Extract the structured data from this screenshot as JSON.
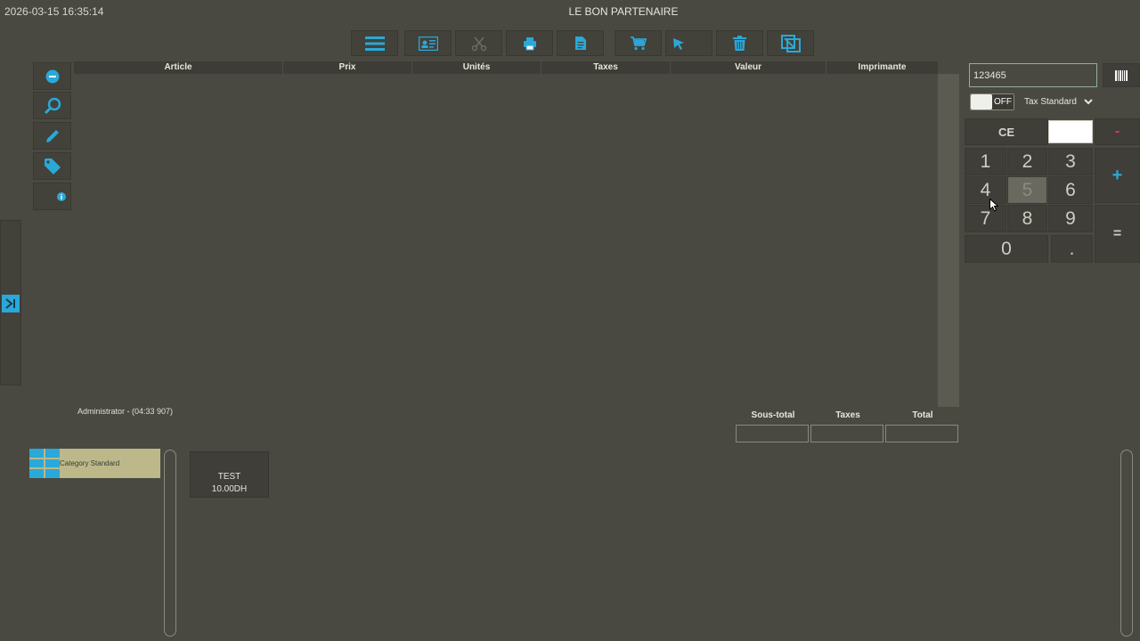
{
  "header": {
    "datetime": "2026-03-15 16:35:14",
    "title": "LE BON PARTENAIRE"
  },
  "toolbar": {
    "buttons": [
      {
        "name": "menu-button",
        "icon": "hamburger-icon"
      },
      {
        "name": "customer-card-button",
        "icon": "id-card-icon"
      },
      {
        "name": "split-button",
        "icon": "scissors-icon",
        "disabled": true
      },
      {
        "name": "print-button",
        "icon": "printer-icon"
      },
      {
        "name": "document-button",
        "icon": "document-icon"
      },
      {
        "name": "cart-button",
        "icon": "cart-icon"
      },
      {
        "name": "pick-button",
        "icon": "pointer-icon"
      },
      {
        "name": "delete-button",
        "icon": "trash-icon"
      },
      {
        "name": "transfer-button",
        "icon": "transfer-icon"
      }
    ]
  },
  "side_actions": [
    {
      "name": "remove-line-button",
      "icon": "minus-circle-icon"
    },
    {
      "name": "search-button",
      "icon": "magnifier-icon"
    },
    {
      "name": "edit-button",
      "icon": "pencil-icon"
    },
    {
      "name": "discount-button",
      "icon": "tag-icon"
    },
    {
      "name": "info-button",
      "icon": "info-icon"
    }
  ],
  "ticket": {
    "columns": [
      "Article",
      "Prix",
      "Unités",
      "Taxes",
      "Valeur",
      "Imprimante"
    ],
    "rows": []
  },
  "user_info": "Administrator - (04:33 907)",
  "totals": {
    "subtotal_label": "Sous-total",
    "taxes_label": "Taxes",
    "total_label": "Total",
    "subtotal_value": "",
    "taxes_value": "",
    "total_value": ""
  },
  "input": {
    "code_value": "123465"
  },
  "tax": {
    "toggle_state": "OFF",
    "selected": "Tax Standard"
  },
  "keypad": {
    "ce": "CE",
    "minus": "-",
    "plus": "+",
    "equals": "=",
    "digits": [
      "1",
      "2",
      "3",
      "4",
      "5",
      "6",
      "7",
      "8",
      "9",
      "0",
      "."
    ]
  },
  "categories": [
    {
      "label": "Category Standard"
    }
  ],
  "products": [
    {
      "name": "TEST",
      "price": "10.00DH"
    }
  ],
  "colors": {
    "background": "#4a4941",
    "accent": "#2aa8d8",
    "minus_key": "#e0336a",
    "plus_key": "#2aa8d8",
    "category_bg": "#bdb88a"
  }
}
